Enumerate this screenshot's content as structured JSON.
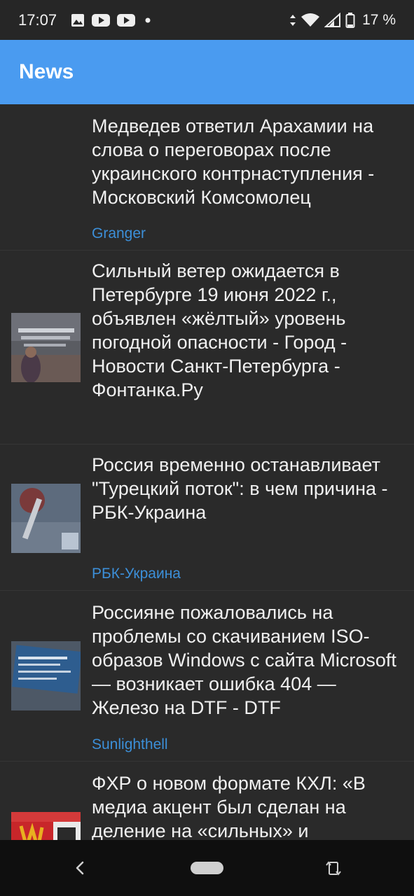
{
  "status_bar": {
    "time": "17:07",
    "battery_text": "17 %",
    "icons_left": [
      "image-icon",
      "youtube-icon",
      "youtube-icon",
      "dot-icon"
    ],
    "icons_right": [
      "data-arrows-icon",
      "wifi-icon",
      "signal-icon",
      "battery-icon"
    ]
  },
  "appbar": {
    "title": "News",
    "color": "#4a9bf0"
  },
  "articles": [
    {
      "title": "Медведев ответил Арахамии на слова о переговорах после украинского контрнаступления - Московский Комсомолец",
      "source": "Granger",
      "has_thumbnail": false
    },
    {
      "title": "Сильный ветер ожидается в Петербурге 19 июня 2022 г., объявлен «жёлтый» уровень погодной опасности - Город - Новости Санкт-Петербурга - Фонтанка.Ру",
      "source": "",
      "has_thumbnail": true
    },
    {
      "title": "Россия временно останавливает \"Турецкий поток\": в чем причина - РБК-Украина",
      "source": "РБК-Украина",
      "has_thumbnail": true
    },
    {
      "title": "Россияне пожаловались на проблемы со скачиванием ISO-образов Windows с сайта Microsoft — возникает ошибка 404 — Железо на DTF - DTF",
      "source": "Sunlighthell",
      "has_thumbnail": true
    },
    {
      "title": "ФХР о новом формате КХЛ: «В медиа акцент был сделан на деление на «сильных» и",
      "source": "",
      "has_thumbnail": true
    }
  ],
  "nav_bar": {
    "buttons": [
      "back-icon",
      "home-pill",
      "rotate-icon"
    ]
  },
  "colors": {
    "background": "#2a2a2a",
    "source_link": "#3c8fd8"
  }
}
